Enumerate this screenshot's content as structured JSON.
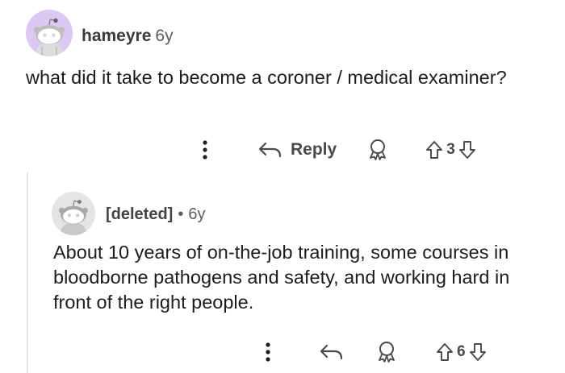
{
  "comment": {
    "author": "hameyre",
    "age": "6y",
    "body": "what did it take to become a coroner / medical examiner?",
    "avatar_icon": "snoo-avatar-icon",
    "actions": {
      "more_icon": "more-vertical-icon",
      "reply_icon": "reply-arrow-icon",
      "reply_label": "Reply",
      "award_icon": "award-icon",
      "upvote_icon": "upvote-arrow-icon",
      "vote_count": "3",
      "downvote_icon": "downvote-arrow-icon"
    }
  },
  "reply": {
    "author": "[deleted]",
    "separator": "•",
    "age": "6y",
    "body": "About 10 years of on-the-job training, some courses in bloodborne pathogens and safety, and working hard in front of the right people.",
    "avatar_icon": "snoo-avatar-icon",
    "actions": {
      "more_icon": "more-vertical-icon",
      "reply_icon": "reply-arrow-icon",
      "award_icon": "award-icon",
      "upvote_icon": "upvote-arrow-icon",
      "vote_count": "6",
      "downvote_icon": "downvote-arrow-icon"
    }
  },
  "colors": {
    "avatar_top_bg": "#dcc8f2",
    "avatar_reply_bg": "#e4e4e4",
    "text": "#1c1c1c",
    "muted": "#5c5c5c",
    "thread_line": "#e5e5e5"
  }
}
